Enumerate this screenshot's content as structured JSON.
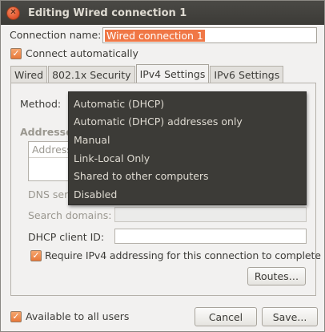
{
  "window": {
    "title": "Editing Wired connection 1"
  },
  "connection": {
    "name_label": "Connection name:",
    "name_value": "Wired connection 1",
    "auto_connect_label": "Connect automatically",
    "auto_connect_checked": true
  },
  "tabs": [
    {
      "label": "Wired",
      "active": false
    },
    {
      "label": "802.1x Security",
      "active": false
    },
    {
      "label": "IPv4 Settings",
      "active": true
    },
    {
      "label": "IPv6 Settings",
      "active": false
    }
  ],
  "ipv4": {
    "method_label": "Method:",
    "addresses_label": "Addresses",
    "address_col": "Address",
    "dns_label": "DNS servers:",
    "search_label": "Search domains:",
    "dhcp_label": "DHCP client ID:",
    "require_label": "Require IPv4 addressing for this connection to complete",
    "require_checked": true,
    "routes_button": "Routes…"
  },
  "method_menu": {
    "options": [
      "Automatic (DHCP)",
      "Automatic (DHCP) addresses only",
      "Manual",
      "Link-Local Only",
      "Shared to other computers",
      "Disabled"
    ]
  },
  "footer": {
    "all_users_label": "Available to all users",
    "all_users_checked": true,
    "cancel_button": "Cancel",
    "save_button": "Save..."
  },
  "colors": {
    "accent": "#f07746",
    "titlebar": "#3c3b37",
    "menu_bg": "#3c3b37"
  }
}
